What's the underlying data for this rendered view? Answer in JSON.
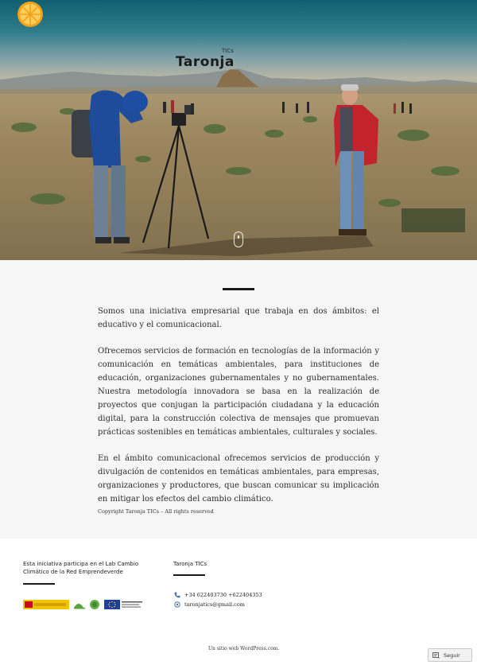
{
  "header": {
    "logo_word": "Taronja",
    "logo_suffix": "TICs",
    "logo_icon": "orange-slice-icon",
    "scroll_icon": "scroll-down-icon"
  },
  "article": {
    "paragraphs": [
      "Somos una iniciativa empresarial que trabaja en dos ámbitos: el educativo y el comunicacional.",
      "Ofrecemos servicios de formación en tecnologías de la información y comunicación en temáticas ambientales, para instituciones de educación, organizaciones gubernamentales y no gubernamentales. Nuestra metodología innovadora se basa en la realización de proyectos que conjugan la participación ciudadana y la educación digital, para la construcción colectiva de mensajes que promuevan prácticas sostenibles en temáticas ambientales, culturales y sociales.",
      "En el ámbito comunicacional ofrecemos servicios de producción y divulgación de contenidos en temáticas ambientales, para empresas, organizaciones y productores, que buscan comunicar su implicación en mitigar los efectos del cambio climático."
    ],
    "copyright": "Copyright Taronja TICs – All rights reserved"
  },
  "footer": {
    "widget1": {
      "title": "Esta iniciativa participa en el Lab Cambio Climático de la Red Emprendeverde"
    },
    "widget2": {
      "title": "Taronja TICs",
      "phone": "+34 622403730 +622404353",
      "email": "taronjatics@gmail.com"
    },
    "credit": "Un sitio web WordPress.com.",
    "follow_label": "Seguir"
  },
  "colors": {
    "accent_orange": "#f0a020",
    "footer_icon_blue": "#4a6fa5"
  }
}
